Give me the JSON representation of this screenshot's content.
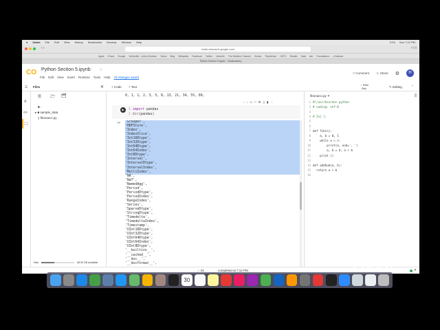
{
  "mac_menu": {
    "app": "Safari",
    "items": [
      "File",
      "Edit",
      "View",
      "History",
      "Bookmarks",
      "Develop",
      "Window",
      "Help"
    ],
    "battery": "27%",
    "clock": "Sun 7:12 PM"
  },
  "browser": {
    "url": "colab.research.google.com",
    "tab_title": "Python Section 5.ipynb - Colaboratory",
    "bookmarks": [
      "Apple",
      "iCloud",
      "Google",
      "Vertomille - Lots-In Bonnes",
      "Yahoo",
      "Bing",
      "Wikipedia",
      "Facebook",
      "Twitter",
      "LinkedIn",
      "The Weather Channel",
      "Zenutu",
      "TripAdvisor",
      "HDTV",
      "Reader",
      "Data",
      "site",
      "Foundations - ...| Kaboola"
    ]
  },
  "colab": {
    "logo": "CO",
    "title": "Python Section 5.ipynb",
    "menu": [
      "File",
      "Edit",
      "View",
      "Insert",
      "Runtime",
      "Tools",
      "Help"
    ],
    "saved": "All changes saved",
    "comment": "Comment",
    "share": "Share",
    "avatar": "H",
    "add_code": "+ Code",
    "add_text": "+ Text",
    "ram": "RAM",
    "disk": "Disk",
    "editing": "Editing"
  },
  "files": {
    "title": "Files",
    "items": [
      "..",
      "sample_data",
      "fibonacci.py"
    ],
    "disk_label": "Disk",
    "disk_avail": "68.94 GB available",
    "disk_used": 0.4
  },
  "notebook": {
    "prev_output": "0, 1, 1, 2, 3, 5, 8, 13, 21, 34, 55, 89,",
    "code": [
      {
        "n": "1",
        "kw": "import",
        "rest": " pandas"
      },
      {
        "n": "2",
        "kw": "dir",
        "rest": "(pandas)"
      }
    ],
    "output": [
      "'Grouper',",
      "'HDFStore',",
      "'Index',",
      "'IndexSlice',",
      "'Int16Dtype',",
      "'Int32Dtype',",
      "'Int64Dtype',",
      "'Int64Index',",
      "'Int8Dtype',",
      "'Interval',",
      "'IntervalDtype',",
      "'IntervalIndex',",
      "'MultiIndex',",
      "'NA',",
      "'NaT',",
      "'NamedAgg',",
      "'Period',",
      "'PeriodDtype',",
      "'PeriodIndex',",
      "'RangeIndex',",
      "'Series',",
      "'SparseDtype',",
      "'StringDtype',",
      "'Timedelta',",
      "'TimedeltaIndex',",
      "'Timestamp',",
      "'UInt16Dtype',",
      "'UInt32Dtype',",
      "'UInt64Dtype',",
      "'UInt64Index',",
      "'UInt8Dtype',",
      "'__builtins__',",
      "'__cached__',",
      "'__doc__',",
      "'__docformat__',"
    ],
    "selected_count": 13
  },
  "editor": {
    "tab": "fibonacci.py",
    "lines": [
      "#!/usr/bin/env python",
      "# coding: utf-8",
      "",
      "# In[ ]:",
      "",
      "",
      "def fib(n):",
      "    a, b = 0, 1",
      "    while a < n:",
      "        print(a, end=', ')",
      "        a, b = b, a + b",
      "    print ()",
      "",
      "def addSum(a, b):",
      "  return a + b",
      ""
    ]
  },
  "status": {
    "time": "0s",
    "text": "completed at 7:12 PM"
  },
  "zoom_logo": "zoom",
  "dock": [
    "Finder",
    "Launchpad",
    "Safari",
    "FaceTime",
    "Preview",
    "Messages",
    "Maps",
    "Photos",
    "Notes Book",
    "Apple TV",
    "Calendar",
    "Reminders",
    "Notes",
    "Parallels",
    "Music",
    "Podcasts",
    "Numbers",
    "Keynote",
    "Pages",
    "System Preferences",
    "Parallels 2",
    "Terminal",
    "Zoom",
    "Script",
    "Documents",
    "Trash"
  ],
  "calendar_day": "30"
}
